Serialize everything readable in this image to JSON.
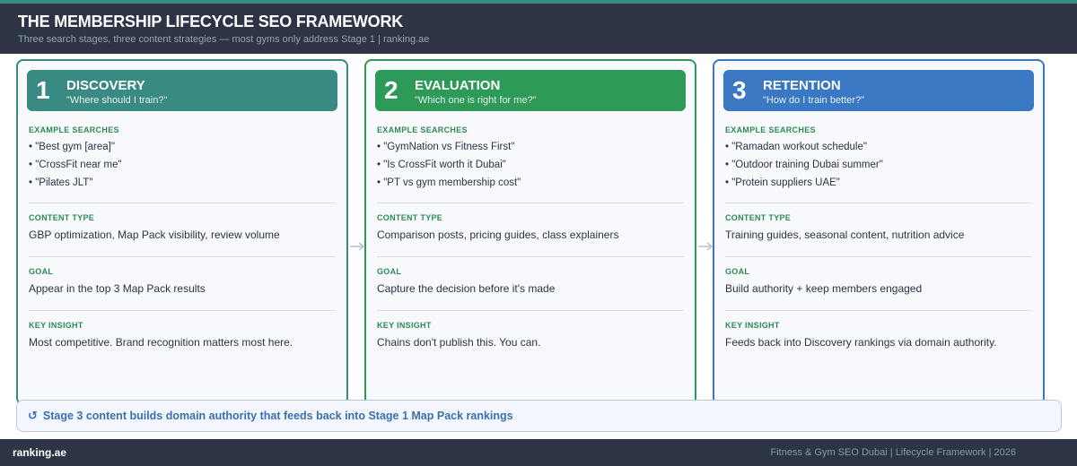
{
  "header": {
    "title": "THE MEMBERSHIP LIFECYCLE SEO FRAMEWORK",
    "subtitle": "Three search stages, three content strategies — most gyms only address Stage 1  |  ranking.ae"
  },
  "stages": [
    {
      "number": "1",
      "name": "DISCOVERY",
      "question": "\"Where should I train?\"",
      "color": "#3a8a84",
      "searches_label": "EXAMPLE SEARCHES",
      "searches": [
        "• \"Best gym [area]\"",
        "• \"CrossFit near me\"",
        "• \"Pilates JLT\""
      ],
      "content_label": "CONTENT TYPE",
      "content": "GBP optimization, Map Pack visibility, review volume",
      "goal_label": "GOAL",
      "goal": "Appear in the top 3 Map Pack results",
      "insight_label": "KEY INSIGHT",
      "insight": "Most competitive. Brand recognition matters most here."
    },
    {
      "number": "2",
      "name": "EVALUATION",
      "question": "\"Which one is right for me?\"",
      "color": "#2e9a57",
      "searches_label": "EXAMPLE SEARCHES",
      "searches": [
        "• \"GymNation vs Fitness First\"",
        "• \"Is CrossFit worth it Dubai\"",
        "• \"PT vs gym membership cost\""
      ],
      "content_label": "CONTENT TYPE",
      "content": "Comparison posts, pricing guides, class explainers",
      "goal_label": "GOAL",
      "goal": "Capture the decision before it's made",
      "insight_label": "KEY INSIGHT",
      "insight": "Chains don't publish this. You can."
    },
    {
      "number": "3",
      "name": "RETENTION",
      "question": "\"How do I train better?\"",
      "color": "#3a78c4",
      "searches_label": "EXAMPLE SEARCHES",
      "searches": [
        "• \"Ramadan workout schedule\"",
        "• \"Outdoor training Dubai summer\"",
        "• \"Protein suppliers UAE\""
      ],
      "content_label": "CONTENT TYPE",
      "content": "Training guides, seasonal content, nutrition advice",
      "goal_label": "GOAL",
      "goal": "Build authority + keep members engaged",
      "insight_label": "KEY INSIGHT",
      "insight": "Feeds back into Discovery rankings via domain authority."
    }
  ],
  "callout": {
    "icon": "↺",
    "icon_name": "cycle-arrow-icon",
    "text": "Stage 3 content builds domain authority that feeds back into Stage 1 Map Pack rankings"
  },
  "footer": {
    "brand": "ranking.ae",
    "meta": "Fitness & Gym SEO Dubai  |  Lifecycle Framework  |  2026"
  }
}
